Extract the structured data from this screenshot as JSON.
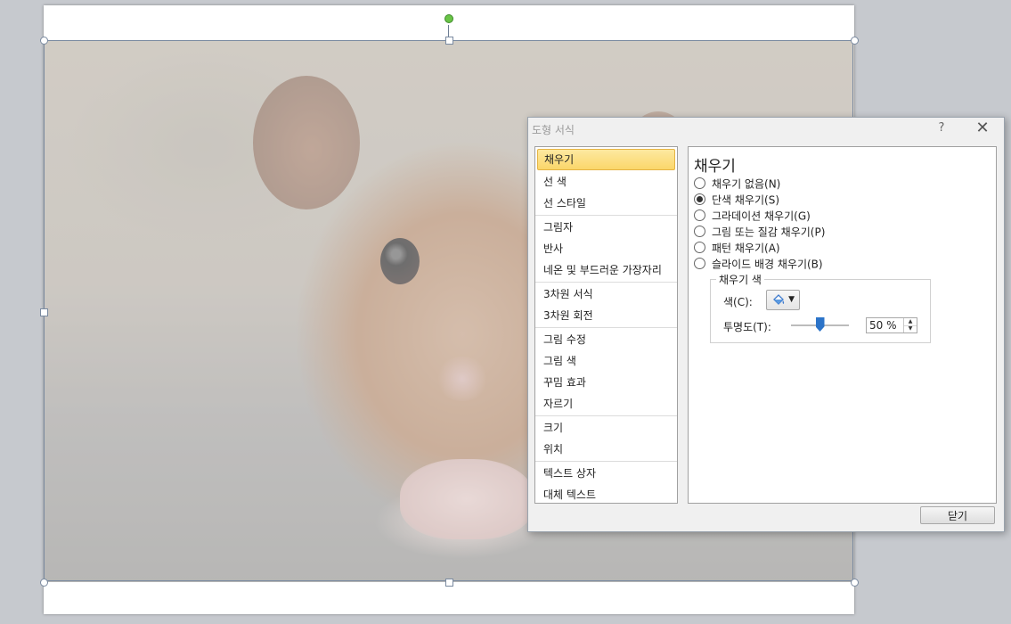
{
  "dialog": {
    "title": "도형 서식",
    "help_label": "?",
    "close_glyph": "✕",
    "close_button_label": "닫기"
  },
  "nav": {
    "groups": [
      [
        "채우기",
        "선 색",
        "선 스타일"
      ],
      [
        "그림자",
        "반사",
        "네온 및 부드러운 가장자리"
      ],
      [
        "3차원 서식",
        "3차원 회전"
      ],
      [
        "그림 수정",
        "그림 색",
        "꾸밈 효과",
        "자르기"
      ],
      [
        "크기",
        "위치"
      ],
      [
        "텍스트 상자",
        "대체 텍스트"
      ]
    ],
    "selected": "채우기"
  },
  "panel": {
    "title": "채우기",
    "options": [
      {
        "label": "채우기 없음(N)",
        "checked": false
      },
      {
        "label": "단색 채우기(S)",
        "checked": true
      },
      {
        "label": "그라데이션 채우기(G)",
        "checked": false
      },
      {
        "label": "그림 또는 질감 채우기(P)",
        "checked": false
      },
      {
        "label": "패턴 채우기(A)",
        "checked": false
      },
      {
        "label": "슬라이드 배경 채우기(B)",
        "checked": false
      }
    ],
    "fill_color_group": {
      "title": "채우기 색",
      "color_label": "색(C):",
      "transparency_label": "투명도(T):",
      "transparency_value": "50 %",
      "transparency_fraction": 0.5
    }
  },
  "colors": {
    "accent_selection": "#fbd66a",
    "slider_thumb": "#2c74c9",
    "rotate_handle": "#69c446"
  },
  "icons": {
    "color_picker": "paint-bucket-icon",
    "dropdown": "caret-down-icon"
  }
}
